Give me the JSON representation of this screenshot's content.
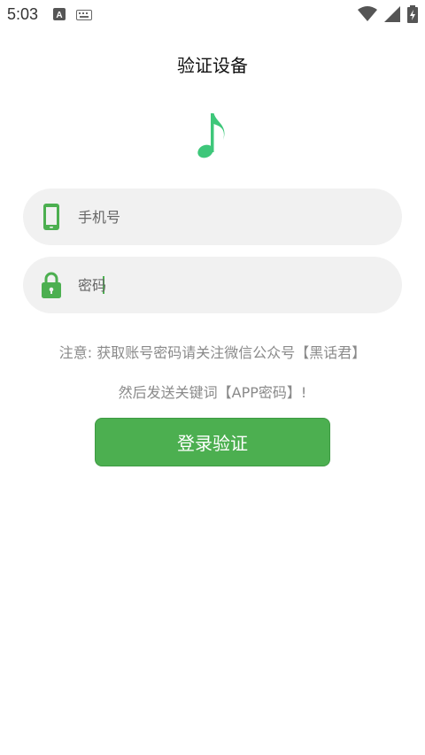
{
  "status_bar": {
    "time": "5:03",
    "icons": [
      "a-notification-icon",
      "keyboard-icon",
      "wifi-icon",
      "signal-icon",
      "battery-charging-icon"
    ]
  },
  "page": {
    "title": "验证设备"
  },
  "logo": {
    "icon": "music-note-icon",
    "color": "#3ec77a"
  },
  "form": {
    "phone_placeholder": "手机号",
    "phone_icon": "phone-icon",
    "password_placeholder": "密码",
    "password_icon": "lock-icon",
    "icon_color": "#4caf50"
  },
  "notice": {
    "line1": "注意: 获取账号密码请关注微信公众号【黑话君】",
    "line2": "然后发送关键词【APP密码】!"
  },
  "actions": {
    "login_label": "登录验证",
    "accent": "#4caf50"
  }
}
